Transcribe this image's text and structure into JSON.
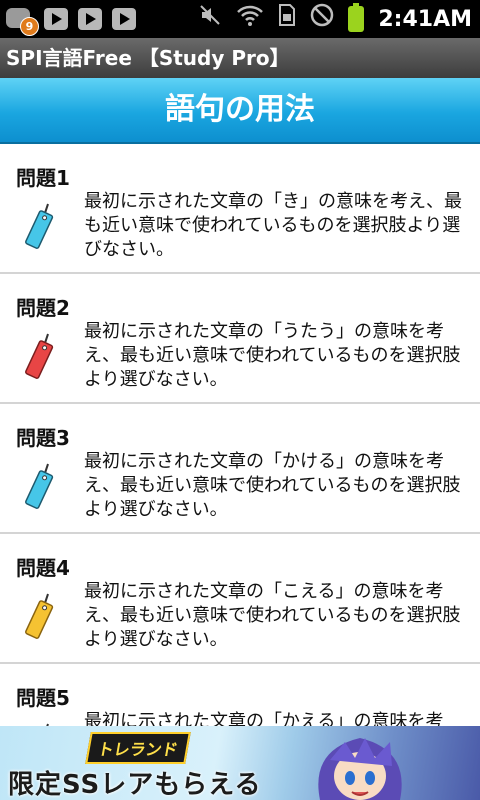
{
  "status_bar": {
    "notification_count": "9",
    "time": "2:41AM",
    "icons": [
      "notification-icon",
      "youtube-icon",
      "youtube-icon",
      "youtube-icon",
      "mute-icon",
      "wifi-icon",
      "sim-icon",
      "no-signal-icon",
      "battery-icon"
    ]
  },
  "app": {
    "title": "SPI言語Free 【Study Pro】"
  },
  "header": {
    "title": "語句の用法"
  },
  "questions": [
    {
      "title": "問題1",
      "description": "最初に示された文章の「き」の意味を考え、最も近い意味で使われているものを選択肢より選びなさい。",
      "tag_color": "#46c6e8"
    },
    {
      "title": "問題2",
      "description": "最初に示された文章の「うたう」の意味を考え、最も近い意味で使われているものを選択肢より選びなさい。",
      "tag_color": "#e84545"
    },
    {
      "title": "問題3",
      "description": "最初に示された文章の「かける」の意味を考え、最も近い意味で使われているものを選択肢より選びなさい。",
      "tag_color": "#46c6e8"
    },
    {
      "title": "問題4",
      "description": "最初に示された文章の「こえる」の意味を考え、最も近い意味で使われているものを選択肢より選びなさい。",
      "tag_color": "#f5c232"
    },
    {
      "title": "問題5",
      "description": "最初に示された文章の「かえる」の意味を考え、最も近い意味で使われているものを選択肢より選びなさい。",
      "tag_color": "#46c6e8"
    }
  ],
  "ad": {
    "logo": "トレランド",
    "text": "限定SSレアもらえる"
  }
}
